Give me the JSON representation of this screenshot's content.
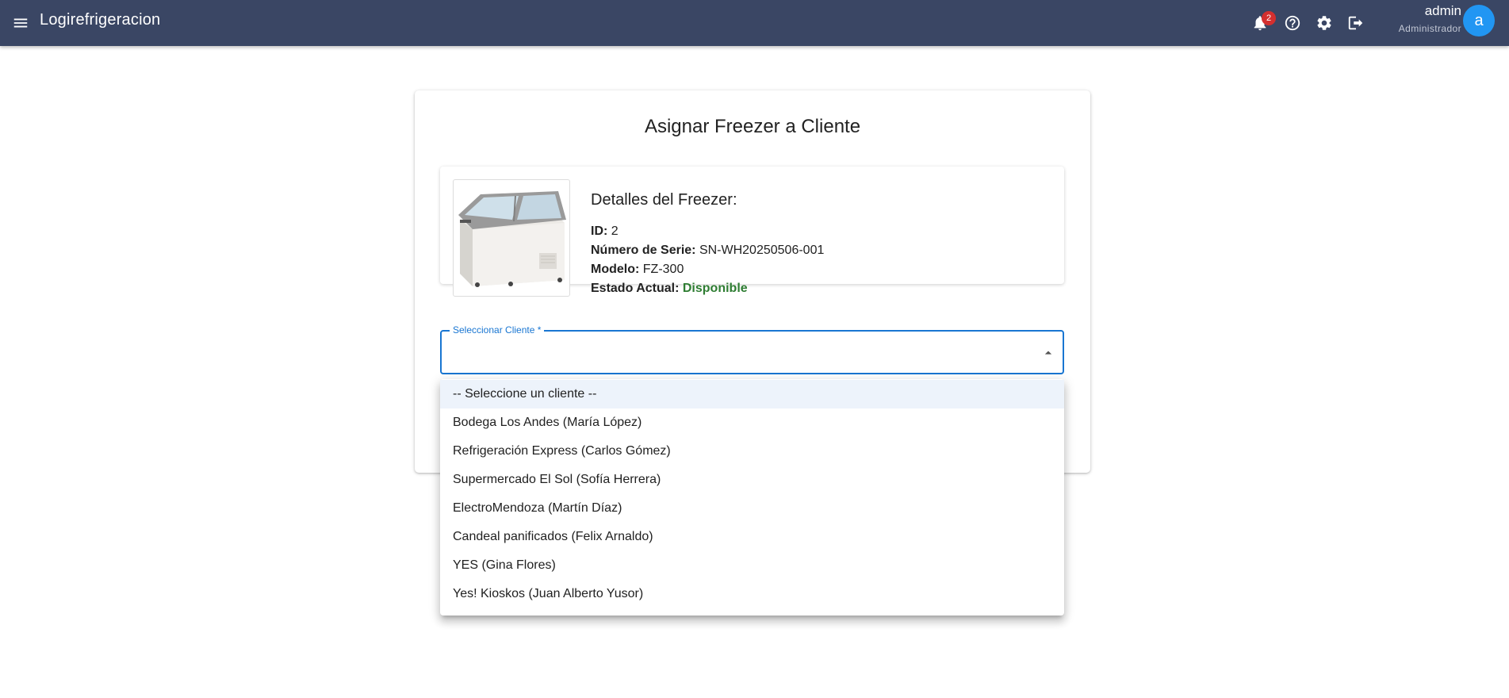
{
  "appbar": {
    "title": "Logirefrigeracion",
    "notifications_count": "2",
    "user_name": "admin",
    "user_role": "Administrador",
    "avatar_letter": "a",
    "bg_color": "#3a4664"
  },
  "form": {
    "title": "Asignar Freezer a Cliente",
    "details": {
      "heading": "Detalles del Freezer:",
      "id_label": "ID:",
      "id_value": "2",
      "serial_label": "Número de Serie:",
      "serial_value": "SN-WH20250506-001",
      "model_label": "Modelo:",
      "model_value": "FZ-300",
      "status_label": "Estado Actual:",
      "status_value": "Disponible",
      "status_color": "#2e7d32"
    },
    "select": {
      "label": "Seleccionar Cliente *",
      "value": ""
    }
  },
  "dropdown": {
    "options": [
      "-- Seleccione un cliente --",
      "Bodega Los Andes (María López)",
      "Refrigeración Express (Carlos Gómez)",
      "Supermercado El Sol (Sofía Herrera)",
      "ElectroMendoza (Martín Díaz)",
      "Candeal panificados (Felix Arnaldo)",
      "YES (Gina Flores)",
      "Yes! Kioskos (Juan Alberto Yusor)"
    ],
    "selected_index": 0
  },
  "icons": {
    "menu": "menu-icon",
    "notifications": "bell-icon",
    "help": "help-circle-icon",
    "settings": "gear-icon",
    "logout": "logout-icon",
    "select_arrow": "arrow-drop-up-icon"
  },
  "colors": {
    "accent": "#1976d2",
    "avatar": "#2196f3",
    "badge": "#d32f2f"
  }
}
